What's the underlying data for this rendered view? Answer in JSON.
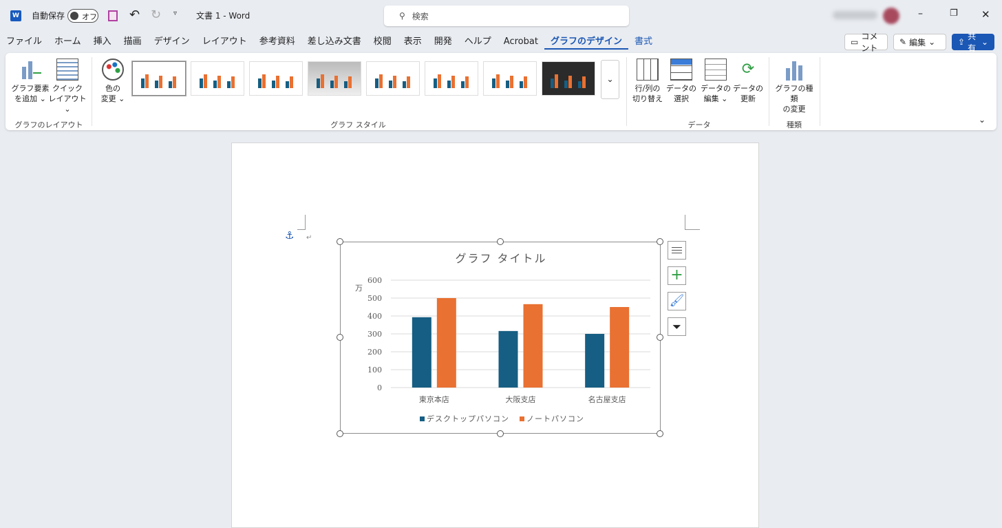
{
  "titlebar": {
    "autosave_label": "自動保存",
    "autosave_state": "オフ",
    "doc_title": "文書 1  -  Word",
    "search_placeholder": "検索"
  },
  "tabs": [
    "ファイル",
    "ホーム",
    "挿入",
    "描画",
    "デザイン",
    "レイアウト",
    "参考資料",
    "差し込み文書",
    "校閲",
    "表示",
    "開発",
    "ヘルプ",
    "Acrobat",
    "グラフのデザイン",
    "書式"
  ],
  "active_tab": "グラフのデザイン",
  "right_buttons": {
    "comment": "コメント",
    "edit": "編集",
    "share": "共有"
  },
  "ribbon": {
    "layout_group": {
      "label": "グラフのレイアウト",
      "add_element": [
        "グラフ要素",
        "を追加 ⌄"
      ],
      "quick_layout": [
        "クイック",
        "レイアウト ⌄"
      ]
    },
    "style_group": {
      "label": "グラフ スタイル",
      "change_colors": [
        "色の",
        "変更 ⌄"
      ]
    },
    "data_group": {
      "label": "データ",
      "switch": [
        "行/列の",
        "切り替え"
      ],
      "select": [
        "データの",
        "選択"
      ],
      "edit": [
        "データの",
        "編集 ⌄"
      ],
      "refresh": [
        "データの",
        "更新"
      ]
    },
    "type_group": {
      "label": "種類",
      "change_type": [
        "グラフの種類",
        "の変更"
      ]
    }
  },
  "colors": {
    "accent": "#1b57b4",
    "desktop": "#165e83",
    "notebook": "#e97132"
  },
  "chart_data": {
    "type": "bar",
    "title": "グラフ タイトル",
    "ylabel": "万",
    "categories": [
      "東京本店",
      "大阪支店",
      "名古屋支店"
    ],
    "series": [
      {
        "name": "デスクトップパソコン",
        "values": [
          393,
          316,
          300
        ]
      },
      {
        "name": "ノートパソコン",
        "values": [
          500,
          466,
          450
        ]
      }
    ],
    "ylim": [
      0,
      600
    ],
    "yticks": [
      "0",
      "100",
      "200",
      "300",
      "400",
      "500",
      "600"
    ],
    "grid": true,
    "legend": "bottom"
  }
}
